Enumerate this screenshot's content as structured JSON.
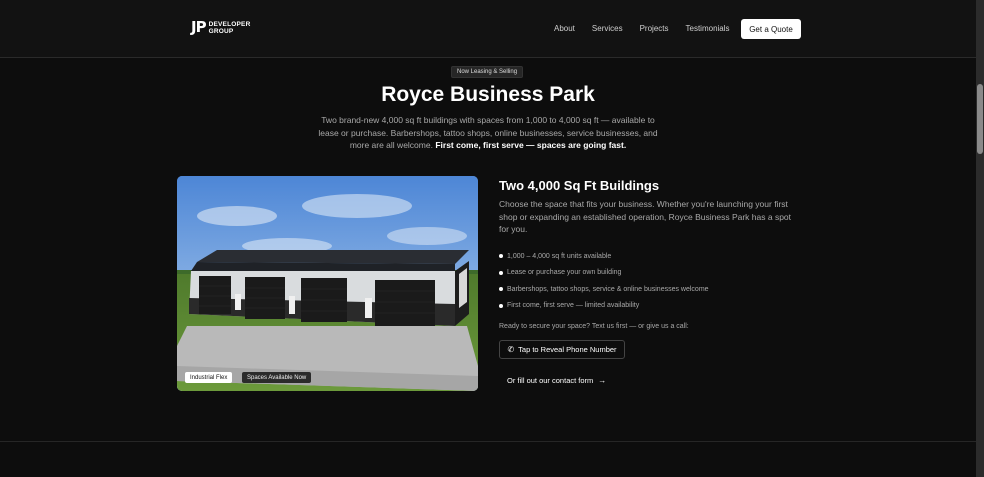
{
  "header": {
    "logo_mark": "JP",
    "logo_line1": "DEVELOPER",
    "logo_line2": "GROUP",
    "nav": [
      "About",
      "Services",
      "Projects",
      "Testimonials"
    ],
    "cta": "Get a Quote"
  },
  "hero": {
    "badge": "Now Leasing & Selling",
    "title": "Royce Business Park",
    "description": "Two brand-new 4,000 sq ft buildings with spaces from 1,000 to 4,000 sq ft — available to lease or purchase. Barbershops, tattoo shops, online businesses, service businesses, and more are all welcome.",
    "description_bold": "First come, first serve — spaces are going fast."
  },
  "card": {
    "tags": [
      "Industrial Flex",
      "Spaces Available Now"
    ]
  },
  "details": {
    "heading": "Two 4,000 Sq Ft Buildings",
    "text": "Choose the space that fits your business. Whether you're launching your first shop or expanding an established operation, Royce Business Park has a spot for you.",
    "bullets": [
      "1,000 – 4,000 sq ft units available",
      "Lease or purchase your own building",
      "Barbershops, tattoo shops, service & online businesses welcome",
      "First come, first serve — limited availability"
    ],
    "ready": "Ready to secure your space? Text us first — or give us a call:",
    "phone_button": "Tap to Reveal Phone Number",
    "contact_link": "Or fill out our contact form"
  },
  "icons": {
    "phone": "phone-icon",
    "arrow": "arrow-right-icon"
  }
}
